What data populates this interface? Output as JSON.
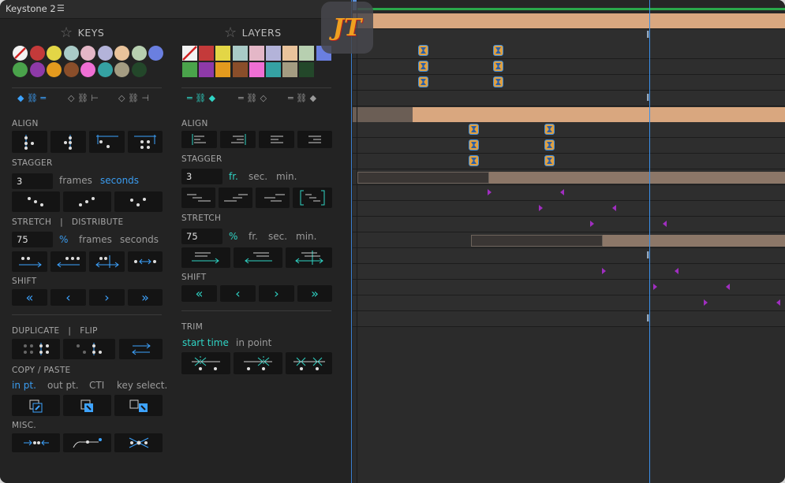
{
  "window": {
    "title": "Keystone 2",
    "menu_icon": "hamburger-icon"
  },
  "keys": {
    "header": "KEYS",
    "swatch_colors": [
      "none",
      "#c43a3a",
      "#e3d646",
      "#a9cbc7",
      "#e4b7c7",
      "#b3b3d9",
      "#e9c39b",
      "#b7cfb0",
      "#6a7fe0",
      "#4aa34b",
      "#8e3aa8",
      "#e39a1e",
      "#8a4e2a",
      "#ef6fd4",
      "#35a2a3",
      "#a49c82",
      "#23472a"
    ],
    "align_label": "ALIGN",
    "stagger_label": "STAGGER",
    "stagger_value": "3",
    "stagger_units": [
      "frames",
      "seconds"
    ],
    "stagger_active_unit": "seconds",
    "stretch_label": "STRETCH",
    "stretch_sep": "|",
    "distribute_label": "DISTRIBUTE",
    "stretch_value": "75",
    "stretch_units": [
      "%",
      "frames",
      "seconds"
    ],
    "shift_label": "SHIFT",
    "shift_buttons": [
      "«",
      "‹",
      "›",
      "»"
    ],
    "duplicate_label": "DUPLICATE",
    "dup_sep": "|",
    "flip_label": "FLIP",
    "copy_label": "COPY / PASTE",
    "copy_options": [
      "in pt.",
      "out pt.",
      "CTI",
      "key select."
    ],
    "misc_label": "MISC."
  },
  "layers": {
    "header": "LAYERS",
    "swatch_colors": [
      "none",
      "#c43a3a",
      "#e3d646",
      "#a9cbc7",
      "#e4b7c7",
      "#b3b3d9",
      "#e9c39b",
      "#b7cfb0",
      "#6a7fe0",
      "#4aa34b",
      "#8e3aa8",
      "#e39a1e",
      "#8a4e2a",
      "#ef6fd4",
      "#35a2a3",
      "#a49c82",
      "#23472a"
    ],
    "align_label": "ALIGN",
    "stagger_label": "STAGGER",
    "stagger_value": "3",
    "stagger_units": [
      "fr.",
      "sec.",
      "min."
    ],
    "stretch_label": "STRETCH",
    "stretch_value": "75",
    "stretch_units": [
      "%",
      "fr.",
      "sec.",
      "min."
    ],
    "shift_label": "SHIFT",
    "shift_buttons": [
      "«",
      "‹",
      "›",
      "»"
    ],
    "trim_label": "TRIM",
    "trim_options": [
      "start time",
      "in point"
    ]
  },
  "logo": {
    "text": "JT"
  },
  "timeline": {
    "cti_marker": "I"
  }
}
